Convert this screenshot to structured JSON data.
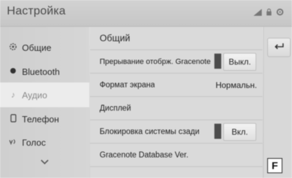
{
  "header": {
    "title": "Настройка",
    "status_icons": [
      "signal-icon",
      "lock-icon",
      "settings-icon"
    ]
  },
  "sidebar": {
    "items": [
      {
        "label": "Общие",
        "icon": "gear-icon",
        "active": false
      },
      {
        "label": "Bluetooth",
        "icon": "bluetooth-icon",
        "active": false
      },
      {
        "label": "Аудио",
        "icon": "music-note-icon",
        "active": true
      },
      {
        "label": "Телефон",
        "icon": "phone-icon",
        "active": false
      },
      {
        "label": "Голос",
        "icon": "voice-icon",
        "active": false
      }
    ],
    "more_icon": "chevron-down-icon"
  },
  "main": {
    "section_title": "Общий",
    "rows": [
      {
        "label": "Прерывание отобрж. Gracenote",
        "control": "toggle",
        "value": "Выкл."
      },
      {
        "label": "Формат экрана",
        "control": "value",
        "value": "Нормальн."
      },
      {
        "label": "Дисплей",
        "control": "none",
        "value": ""
      },
      {
        "label": "Блокировка системы сзади",
        "control": "toggle",
        "value": "Вкл."
      },
      {
        "label": "Gracenote Database Ver.",
        "control": "none",
        "value": ""
      }
    ]
  },
  "rightbar": {
    "back_icon": "back-arrow-icon"
  },
  "annotation": {
    "label": "F"
  }
}
